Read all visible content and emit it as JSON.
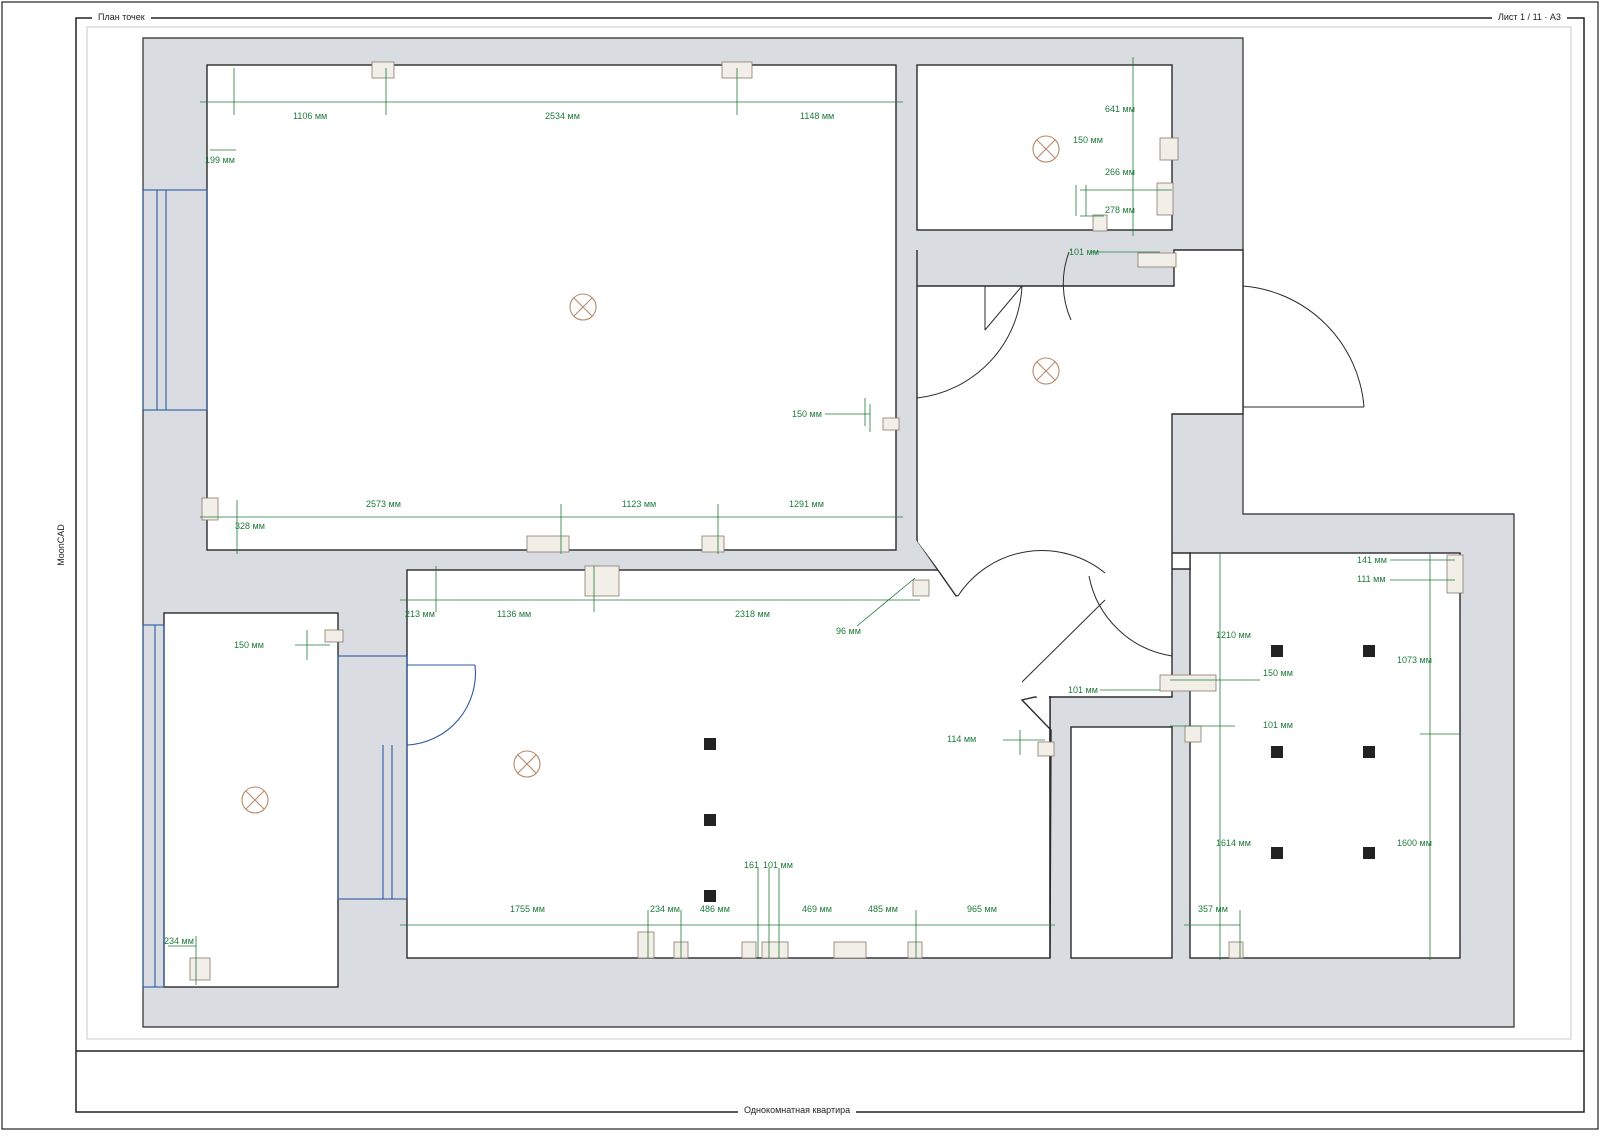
{
  "sheet": {
    "title_left": "План точек",
    "title_right": "Лист 1 / 11 · A3",
    "footer_title": "Однокомнатная квартира",
    "side_label": "MoonCAD"
  },
  "colors": {
    "wall": "#d9dde2",
    "wall_outline": "#2b2b2b",
    "dimension": "#1f7a3a",
    "window": "#2c5aa0",
    "fixture": "#b58a6a",
    "frame": "#222222"
  },
  "icons": {
    "ceiling_light": "ceiling-light-icon",
    "spot_light": "spot-light-icon",
    "socket": "socket-icon",
    "switch": "switch-icon"
  },
  "dimensions": [
    "1106 мм",
    "2534 мм",
    "1148 мм",
    "199 мм",
    "641 мм",
    "150 мм",
    "266 мм",
    "278 мм",
    "101 мм",
    "150 мм",
    "2573 мм",
    "1123 мм",
    "1291 мм",
    "328 мм",
    "213 мм",
    "1136 мм",
    "2318 мм",
    "96 мм",
    "150 мм",
    "141 мм",
    "111 мм",
    "1210 мм",
    "150 мм",
    "1073 мм",
    "101 мм",
    "101 мм",
    "114 мм",
    "1614 мм",
    "1600 мм",
    "161",
    "101 мм",
    "234 мм",
    "486 мм",
    "469 мм",
    "485 мм",
    "965 мм",
    "1755 мм",
    "357 мм",
    "234 мм"
  ]
}
